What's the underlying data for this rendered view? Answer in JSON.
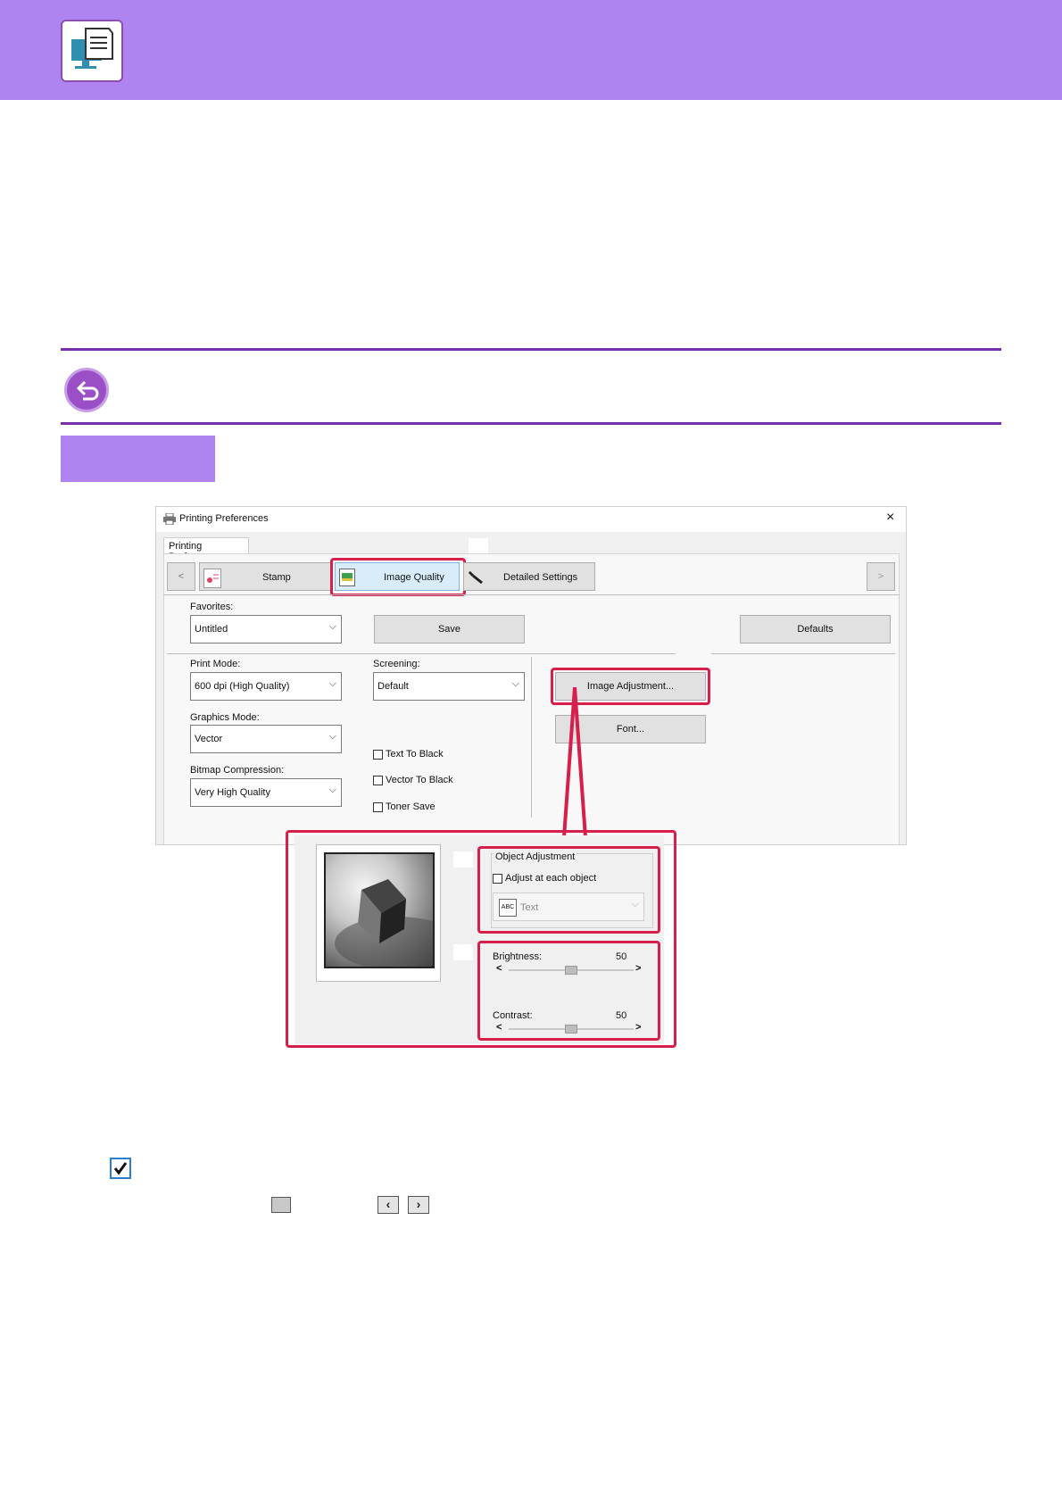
{
  "dialog": {
    "title": "Printing Preferences",
    "close": "×",
    "tab_label": "Printing Preferences",
    "nav_prev": "<",
    "nav_next": ">",
    "tabs": [
      {
        "label": "Stamp"
      },
      {
        "label": "Image Quality"
      },
      {
        "label": "Detailed Settings"
      }
    ],
    "favorites": {
      "label": "Favorites:",
      "value": "Untitled",
      "save_button": "Save",
      "defaults_button": "Defaults"
    },
    "print_mode": {
      "label": "Print Mode:",
      "value": "600 dpi (High Quality)"
    },
    "screening": {
      "label": "Screening:",
      "value": "Default"
    },
    "graphics_mode": {
      "label": "Graphics Mode:",
      "value": "Vector"
    },
    "bitmap_compression": {
      "label": "Bitmap Compression:",
      "value": "Very High Quality"
    },
    "checkboxes": [
      "Text To Black",
      "Vector To Black",
      "Toner Save"
    ],
    "image_adjustment_button": "Image Adjustment...",
    "font_button": "Font..."
  },
  "zoom_panel": {
    "object_adjustment": {
      "group_label": "Object Adjustment",
      "checkbox_label": "Adjust at each object",
      "select_icon": "ABC",
      "select_value": "Text"
    },
    "brightness": {
      "label": "Brightness:",
      "value": "50"
    },
    "contrast": {
      "label": "Contrast:",
      "value": "50"
    },
    "slider_left": "<",
    "slider_right": ">"
  },
  "colors": {
    "header": "#b084f0",
    "rule": "#7a2fae",
    "highlight": "#d61f4b"
  }
}
